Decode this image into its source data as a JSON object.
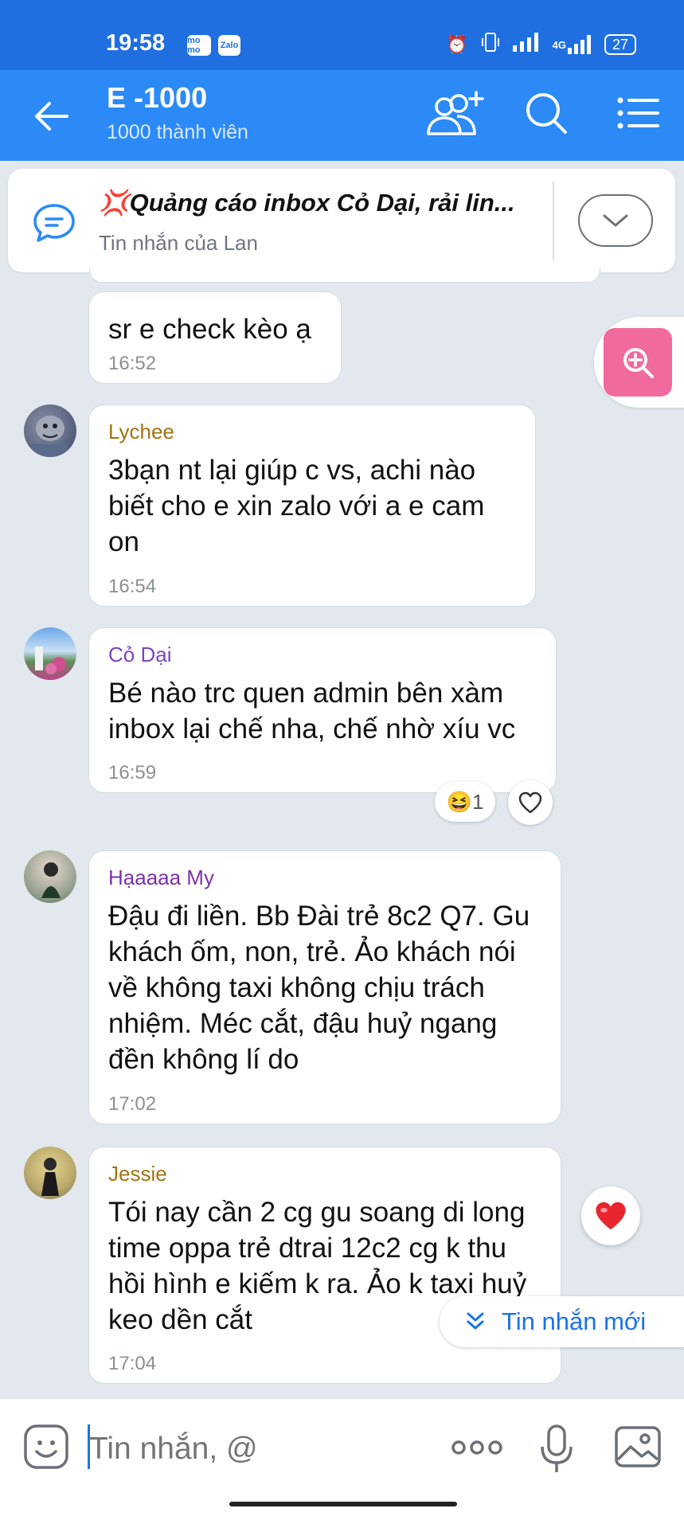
{
  "status_bar": {
    "time": "19:58",
    "app_badges": [
      "mo mo",
      "Zalo"
    ],
    "network": "4G",
    "battery": "27"
  },
  "header": {
    "title": "E -1000",
    "subtitle": "1000 thành viên"
  },
  "pinned": {
    "emoji": "💢",
    "title": "Quảng cáo inbox Cỏ Dại, rải lin...",
    "subtitle": "Tin nhắn của Lan"
  },
  "messages": [
    {
      "sender": "",
      "text": "sr e check kèo ạ",
      "time": "16:52"
    },
    {
      "sender": "Lychee",
      "sender_color": "#a07410",
      "text": "3bạn nt lại giúp c vs, achi nào biết cho e xin zalo với a e cam on",
      "time": "16:54"
    },
    {
      "sender": "Cỏ Dại",
      "sender_color": "#7a45c2",
      "text": "Bé nào trc quen admin bên xàm inbox lại chế nha, chế nhờ xíu vc",
      "time": "16:59",
      "reaction": {
        "emoji": "😆",
        "count": "1"
      }
    },
    {
      "sender": "Hạaaaa My",
      "sender_color": "#7a32a8",
      "text": "Đậu đi liền. Bb Đài trẻ 8c2 Q7. Gu khách ốm, non, trẻ. Ảo khách nói về không taxi không chịu trách nhiệm. Méc cắt, đậu huỷ ngang đền không lí do",
      "time": "17:02"
    },
    {
      "sender": "Jessie",
      "sender_color": "#a07410",
      "text": "Tói nay cần 2 cg gu soang di long time oppa trẻ dtrai 12c2 cg k thu hồi hình e kiếm k ra. Ảo k taxi huỷ keo dền cắt",
      "time": "17:04"
    }
  ],
  "new_messages_label": "Tin nhắn mới",
  "composer": {
    "placeholder": "Tin nhắn, @"
  },
  "colors": {
    "header": "#2b8af6",
    "statusbar": "#1f6fe0",
    "background": "#e3e8ef",
    "zoom_button": "#f06a9e",
    "link": "#1a73e8"
  }
}
